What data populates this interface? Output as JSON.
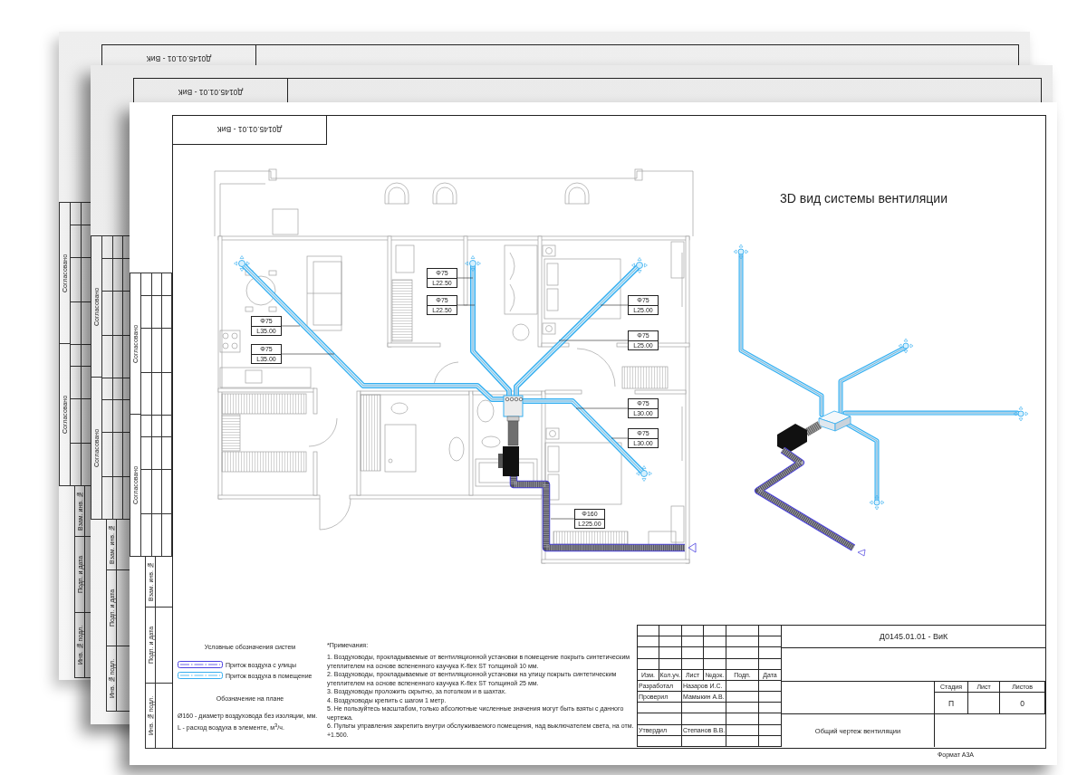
{
  "sheets": [
    {
      "code": "Д0145.01.01 - ВиК",
      "approvals": [
        "Согласовано",
        "Согласовано"
      ],
      "stamps": [
        "Взам. инв. №",
        "Подп. и дата",
        "Инв. № подл."
      ]
    },
    {
      "code": "Д0145.01.01 - ВиК",
      "approvals": [
        "Согласовано",
        "Согласовано"
      ],
      "stamps": [
        "Взам. инв. №",
        "Подп. и дата",
        "Инв. № подл."
      ]
    },
    {
      "code": "Д0145.01.01 - ВиК",
      "approvals": [
        "Согласовано",
        "Согласовано"
      ],
      "stamps": [
        "Взам. инв. №",
        "Подп. и дата",
        "Инв. № подл."
      ]
    }
  ],
  "plan": {
    "tags": [
      {
        "diameter": "Φ75",
        "flow": "L35.00"
      },
      {
        "diameter": "Φ75",
        "flow": "L35.00"
      },
      {
        "diameter": "Φ75",
        "flow": "L22.50"
      },
      {
        "diameter": "Φ75",
        "flow": "L22.50"
      },
      {
        "diameter": "Φ75",
        "flow": "L25.00"
      },
      {
        "diameter": "Φ75",
        "flow": "L25.00"
      },
      {
        "diameter": "Φ75",
        "flow": "L30.00"
      },
      {
        "diameter": "Φ75",
        "flow": "L30.00"
      },
      {
        "diameter": "Φ160",
        "flow": "L225.00"
      }
    ]
  },
  "view_3d": {
    "title": "3D вид системы вентиляции"
  },
  "legend": {
    "title": "Условные обозначения систем",
    "systems": [
      {
        "label": "Приток воздуха с улицы",
        "color": "#4a40e0"
      },
      {
        "label": "Приток воздуха в помещение",
        "color": "#35aef0"
      }
    ],
    "plan_title": "Обозначение на плане",
    "plan_notes": [
      "Ø160 - диаметр воздуховода без изоляции, мм.",
      "L - расход воздуха в элементе, м$^{3}$/ч."
    ]
  },
  "notes": {
    "title": "*Примечания:",
    "items": [
      "1. Воздуховоды, прокладываемые от вентиляционной установки в помещение покрыть синтетическим утеплителем на основе вспененного каучука K-flex ST толщиной 10 мм.",
      "2. Воздуховоды, прокладываемые от вентиляционной установки на улицу покрыть синтетическим утеплителем на основе вспененного каучука K-flex ST толщиной 25 мм.",
      "3. Воздуховоды проложить скрытно, за потолком и в шахтах.",
      "4. Воздуховоды крепить с шагом 1 метр.",
      "5. Не пользуйтесь масштабом, только абсолютные численные значения могут быть взяты с данного чертежа.",
      "6. Пульты управления закрепить внутри обслуживаемого помещения, над выключателем света, на отм. +1.500."
    ]
  },
  "title_block": {
    "revision_headers": [
      "Изм.",
      "Кол.уч.",
      "Лист",
      "№док.",
      "Подп.",
      "Дата"
    ],
    "signatures": [
      {
        "role": "Разработал",
        "name": "Назаров И.С."
      },
      {
        "role": "Проверил",
        "name": "Мамыкин А.В."
      },
      {
        "role": "Утвердил",
        "name": "Степанов В.В."
      }
    ],
    "code": "Д0145.01.01 - ВиК",
    "stages": [
      {
        "label": "Стадия",
        "value": "П"
      },
      {
        "label": "Лист"
      },
      {
        "label": "Листов",
        "value": "0"
      }
    ],
    "title": "Общий чертеж вентиляции",
    "format": "Формат А3А"
  }
}
